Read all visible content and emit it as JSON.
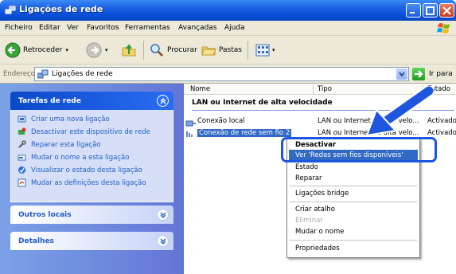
{
  "window": {
    "title": "Ligações de rede"
  },
  "menu": [
    "Ficheiro",
    "Editar",
    "Ver",
    "Favoritos",
    "Ferramentas",
    "Avançadas",
    "Ajuda"
  ],
  "toolbar": {
    "back": "Retroceder",
    "search": "Procurar",
    "folders": "Pastas"
  },
  "address": {
    "label": "Endereço",
    "value": "Ligações de rede",
    "go": "Ir para"
  },
  "tasks": {
    "header": "Tarefas de rede",
    "items": [
      "Criar uma nova ligação",
      "Desactivar este dispositivo de rede",
      "Reparar esta ligação",
      "Mudar o nome a esta ligação",
      "Visualizar o estado desta ligação",
      "Mudar as definições desta ligação"
    ]
  },
  "other_places": {
    "header": "Outros locais"
  },
  "details": {
    "header": "Detalhes"
  },
  "columns": {
    "name": "Nome",
    "type": "Tipo",
    "status": "Estado"
  },
  "group": "LAN ou Internet de alta velocidade",
  "rows": [
    {
      "name": "Conexão local",
      "type": "LAN ou Internet de alta velo...",
      "status": "Activado"
    },
    {
      "name": "Conexão de rede sem fio 2",
      "type": "LAN ou Internet de alta velo...",
      "status": "Activado"
    }
  ],
  "context_menu": {
    "disable": "Desactivar",
    "view_wireless": "Ver 'Redes sem fios disponíveis'",
    "status": "Estado",
    "repair": "Reparar",
    "bridge": "Ligações bridge",
    "shortcut": "Criar atalho",
    "delete": "Eliminar",
    "rename": "Mudar o nome",
    "properties": "Propriedades"
  },
  "colors": {
    "titlebar": "#0a4fd8",
    "task_panel_gradient_end": "#6375d6",
    "selection": "#316ac5",
    "callout": "#1e56e0"
  }
}
